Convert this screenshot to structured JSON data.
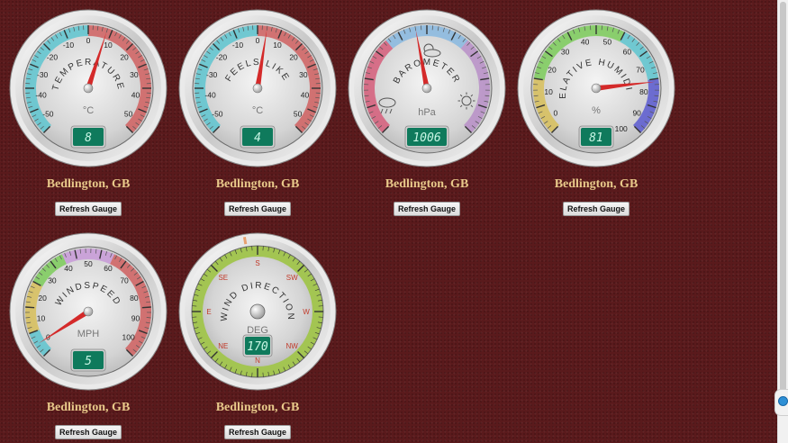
{
  "gauges": [
    {
      "id": "temperature",
      "title": "TEMPERATURE",
      "unit": "°C",
      "lcd": "8",
      "location": "Bedlington, GB",
      "button": "Refresh Gauge",
      "min": -60,
      "max": 60,
      "value": 8,
      "ticks": [
        "-50",
        "-40",
        "-30",
        "-20",
        "-10",
        "0",
        "10",
        "20",
        "30",
        "40",
        "50"
      ],
      "colors": {
        "low": "#5ec6d0",
        "high": "#d06060"
      }
    },
    {
      "id": "feels-like",
      "title": "FEELS LIKE",
      "unit": "°C",
      "lcd": "4",
      "location": "Bedlington, GB",
      "button": "Refresh Gauge",
      "min": -60,
      "max": 60,
      "value": 4,
      "ticks": [
        "-50",
        "-40",
        "-30",
        "-20",
        "-10",
        "0",
        "10",
        "20",
        "30",
        "40",
        "50"
      ],
      "colors": {
        "low": "#5ec6d0",
        "high": "#d06060"
      }
    },
    {
      "id": "barometer",
      "title": "BAROMETER",
      "unit": "hPa",
      "lcd": "1006",
      "location": "Bedlington, GB",
      "button": "Refresh Gauge",
      "min": 960,
      "max": 1060,
      "value": 1006,
      "ticks": [],
      "colors": {
        "low": "#d65d7a",
        "mid": "#88b8e0",
        "high": "#b88fc8"
      }
    },
    {
      "id": "humidity",
      "title": "RELATIVE HUMIDITY",
      "unit": "%",
      "lcd": "81",
      "location": "Bedlington, GB",
      "button": "Refresh Gauge",
      "min": 0,
      "max": 100,
      "value": 81,
      "ticks": [
        "0",
        "10",
        "20",
        "30",
        "40",
        "50",
        "60",
        "70",
        "80",
        "90",
        "100"
      ],
      "colors": {
        "dry": "#d8c05a",
        "ok": "#7ccc5a",
        "humid": "#5ec6d0",
        "wet": "#5a5ad0"
      }
    },
    {
      "id": "windspeed",
      "title": "WINDSPEED",
      "unit": "MPH",
      "lcd": "5",
      "location": "Bedlington, GB",
      "button": "Refresh Gauge",
      "min": 0,
      "max": 110,
      "value": 5,
      "ticks": [
        "0",
        "10",
        "20",
        "30",
        "40",
        "50",
        "60",
        "70",
        "80",
        "90",
        "100"
      ],
      "colors": {
        "calm": "#5ec6d0",
        "light": "#d8c05a",
        "breeze": "#7ccc5a",
        "strong": "#c89ad8",
        "gale": "#d06060"
      }
    },
    {
      "id": "wind-direction",
      "title": "WIND DIRECTION",
      "unit": "DEG",
      "lcd": "170",
      "location": "Bedlington, GB",
      "button": "Refresh Gauge",
      "value": 170,
      "ticks": [
        "S",
        "SW",
        "W",
        "NW",
        "N",
        "NE",
        "E",
        "SE"
      ],
      "colors": {
        "ring": "#a3c552",
        "label": "#c23a2a"
      }
    }
  ],
  "icons": {
    "rain": "rain-cloud-icon",
    "cloud": "sun-cloud-icon",
    "sun": "sun-icon",
    "chat": "chat-icon"
  }
}
